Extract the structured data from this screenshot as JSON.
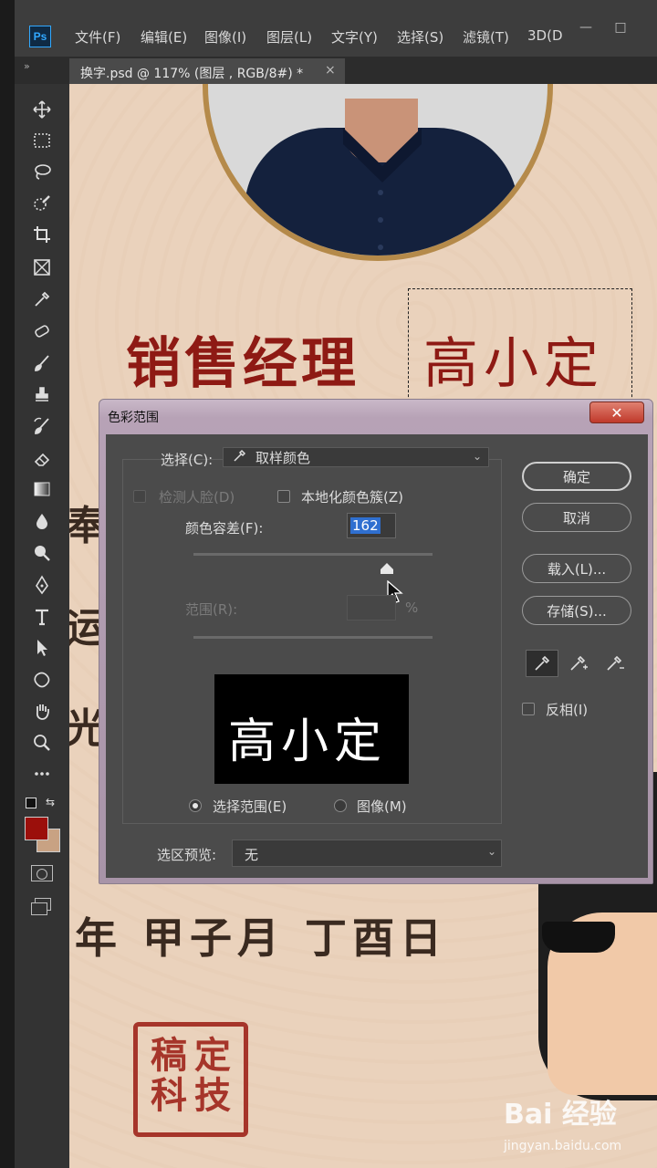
{
  "app": {
    "logo_text": "Ps",
    "menu": [
      "文件(F)",
      "编辑(E)",
      "图像(I)",
      "图层(L)",
      "文字(Y)",
      "选择(S)",
      "滤镜(T)",
      "3D(D"
    ],
    "window_buttons": [
      "—",
      "□"
    ]
  },
  "tab": {
    "panel_toggle": "»",
    "title": "换字.psd @ 117% (图层 , RGB/8#) *",
    "close": "×"
  },
  "toolbar": {
    "tools": [
      "move",
      "marquee",
      "lasso",
      "quick-select",
      "crop",
      "frame",
      "eyedropper",
      "healing",
      "brush",
      "stamp",
      "history-brush",
      "eraser",
      "gradient",
      "blur",
      "dodge",
      "pen",
      "type",
      "path-select",
      "shape",
      "hand",
      "zoom",
      "more"
    ],
    "foreground_color": "#9b0f0b",
    "background_color": "#c8a283"
  },
  "canvas": {
    "job_title": "销售经理",
    "name": "高小定",
    "side_chars": [
      "奉",
      "运",
      "光"
    ],
    "date_line": "年 甲子月 丁酉日",
    "stamp": [
      "稿",
      "定",
      "科",
      "技"
    ],
    "accent_color": "#8e1a14"
  },
  "dialog": {
    "title": "色彩范围",
    "close": "✕",
    "select_label": "选择(C):",
    "select_value": "取样颜色",
    "detect_faces": "检测人脸(D)",
    "localized_clusters": "本地化颜色簇(Z)",
    "fuzziness_label": "颜色容差(F):",
    "fuzziness_value": "162",
    "fuzziness_fraction": 0.81,
    "range_label": "范围(R):",
    "range_unit": "%",
    "preview_text": "高小定",
    "radio_selection": "选择范围(E)",
    "radio_image": "图像(M)",
    "selection_preview_label": "选区预览:",
    "selection_preview_value": "无",
    "buttons": {
      "ok": "确定",
      "cancel": "取消",
      "load": "载入(L)...",
      "save": "存储(S)..."
    },
    "invert": "反相(I)"
  },
  "watermark": {
    "brand": "Bai 经验",
    "url": "jingyan.baidu.com"
  }
}
